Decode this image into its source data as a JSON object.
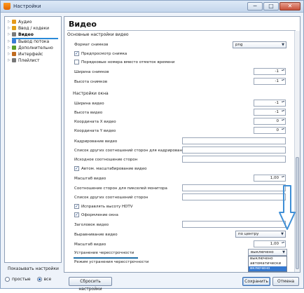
{
  "window": {
    "title": "Настройки",
    "minimize": "─",
    "maximize": "□",
    "close": "✕"
  },
  "sidebar": {
    "items": [
      {
        "label": "Аудио",
        "icon": "audio-icon",
        "color": "#e59a1b"
      },
      {
        "label": "Ввод / кодеки",
        "icon": "codec-icon",
        "color": "#e0a017"
      },
      {
        "label": "Видео",
        "icon": "video-icon",
        "color": "#7a7a7a",
        "selected": true
      },
      {
        "label": "Вывод потока",
        "icon": "stream-output-icon",
        "color": "#3a7bd5"
      },
      {
        "label": "Дополнительно",
        "icon": "advanced-icon",
        "color": "#5aa02c"
      },
      {
        "label": "Интерфейс",
        "icon": "interface-icon",
        "color": "#c06b1f"
      },
      {
        "label": "Плейлист",
        "icon": "playlist-icon",
        "color": "#777777"
      }
    ],
    "selection_underline_color": "#2a8ad8"
  },
  "footer": {
    "show_settings_label": "Показывать настройки",
    "radio_simple": "простые",
    "radio_all": "все",
    "selected_mode": "все",
    "reset_button": "Сбросить настройки",
    "save_button": "Сохранить",
    "cancel_button": "Отмена"
  },
  "panel": {
    "title": "Видео",
    "section_main": "Основные настройки видео",
    "snapshot_format_label": "Формат снимков",
    "snapshot_format_value": "png",
    "preview_snapshot": "Предпросмотр снимка",
    "preview_checked": true,
    "sequential_numbers": "Порядковые номера вместо отметок времени",
    "sequential_checked": false,
    "snapshot_width_label": "Ширина снимков",
    "snapshot_width_value": "-1",
    "snapshot_height_label": "Высота снимков",
    "snapshot_height_value": "-1",
    "section_window": "Настройки окна",
    "video_width_label": "Ширина видео",
    "video_width_value": "-1",
    "video_height_label": "Высота видео",
    "video_height_value": "-1",
    "video_x_label": "Координата X видео",
    "video_x_value": "0",
    "video_y_label": "Координата Y видео",
    "video_y_value": "0",
    "crop_label": "Кадрирование видео",
    "crop_ratios_label": "Список других соотношений сторон для кадрирования",
    "source_aspect_label": "Исходное соотношение сторон",
    "auto_scale": "Автом. масштабирование видео",
    "auto_scale_checked": true,
    "video_scale_label": "Масштаб видео",
    "video_scale_value": "1,00",
    "monitor_aspect_label": "Соотношение сторон для пикселей монитора",
    "other_aspects_label": "Список других соотношений сторон",
    "hdtv_fix": "Исправлять высоту HDTV",
    "hdtv_checked": true,
    "decorations": "Оформление окна",
    "decorations_checked": true,
    "video_title_label": "Заголовок видео",
    "alignment_label": "Выравнивание видео",
    "alignment_value": "по центру",
    "scale_label": "Масштаб видео",
    "scale_value": "1,00",
    "deinterlace_label": "Устранение чересстрочности",
    "deinterlace_value": "выключено",
    "deinterlace_options": [
      "выключено",
      "автоматически",
      "включено"
    ],
    "deinterlace_highlighted": "включено",
    "deinterlace_mode_label": "Режим устранения чересстрочности",
    "annotation_color": "#1e6fa8",
    "arrow_color": "#3f8fd6"
  }
}
